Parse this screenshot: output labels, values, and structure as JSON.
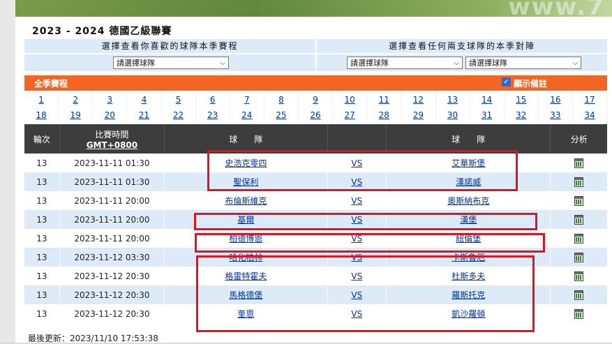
{
  "banner": {
    "watermark": "www.7"
  },
  "title": "2023 - 2024 德國乙級聯賽",
  "selector": {
    "left_header": "選擇查看你喜歡的球隊本季賽程",
    "right_header": "選擇查看任何兩支球隊的本季對陣",
    "left_dropdown": "請選擇球隊",
    "right_dropdown_1": "請選擇球隊",
    "right_dropdown_2": "請選擇球隊"
  },
  "season_bar": {
    "label": "全季賽程",
    "show_notes_label": "顯示備註",
    "show_notes_checked": true
  },
  "rounds_row1": [
    "1",
    "2",
    "3",
    "4",
    "5",
    "6",
    "7",
    "8",
    "9",
    "10",
    "11",
    "12",
    "13",
    "14",
    "15",
    "16",
    "17"
  ],
  "rounds_row2": [
    "18",
    "19",
    "20",
    "21",
    "22",
    "23",
    "24",
    "25",
    "26",
    "27",
    "28",
    "29",
    "30",
    "31",
    "32",
    "33",
    "34"
  ],
  "table": {
    "headers": {
      "round": "輪次",
      "time": "比賽時間",
      "tz": "GMT+0800",
      "home": "球　　隊",
      "away": "球　　隊",
      "analysis": "分析"
    },
    "rows": [
      {
        "round": "13",
        "time": "2023-11-11 01:30",
        "home": "史浩克零四",
        "vs": "VS",
        "away": "艾華斯堡"
      },
      {
        "round": "13",
        "time": "2023-11-11 01:30",
        "home": "聖保利",
        "vs": "VS",
        "away": "漢諾威"
      },
      {
        "round": "13",
        "time": "2023-11-11 20:00",
        "home": "布倫斯維克",
        "vs": "VS",
        "away": "奧斯納布克"
      },
      {
        "round": "13",
        "time": "2023-11-11 20:00",
        "home": "基爾",
        "vs": "VS",
        "away": "漢堡"
      },
      {
        "round": "13",
        "time": "2023-11-11 20:00",
        "home": "柏德博恩",
        "vs": "VS",
        "away": "紐倫堡"
      },
      {
        "round": "13",
        "time": "2023-11-12 03:30",
        "home": "哈化柏林",
        "vs": "VS",
        "away": "卡斯魯厄"
      },
      {
        "round": "13",
        "time": "2023-11-12 20:30",
        "home": "格雷特霍夫",
        "vs": "VS",
        "away": "杜斯多夫"
      },
      {
        "round": "13",
        "time": "2023-11-12 20:30",
        "home": "馬格德堡",
        "vs": "VS",
        "away": "羅斯托克"
      },
      {
        "round": "13",
        "time": "2023-11-12 20:30",
        "home": "奎恩",
        "vs": "VS",
        "away": "凱沙羅頓"
      }
    ]
  },
  "footer": "最後更新：2023/11/10 17:53:38",
  "colors": {
    "accent": "#f26522",
    "header_bg": "#3d3d3d",
    "row_alt": "#dcebf7",
    "highlight": "#e0141e",
    "link": "#003399"
  }
}
